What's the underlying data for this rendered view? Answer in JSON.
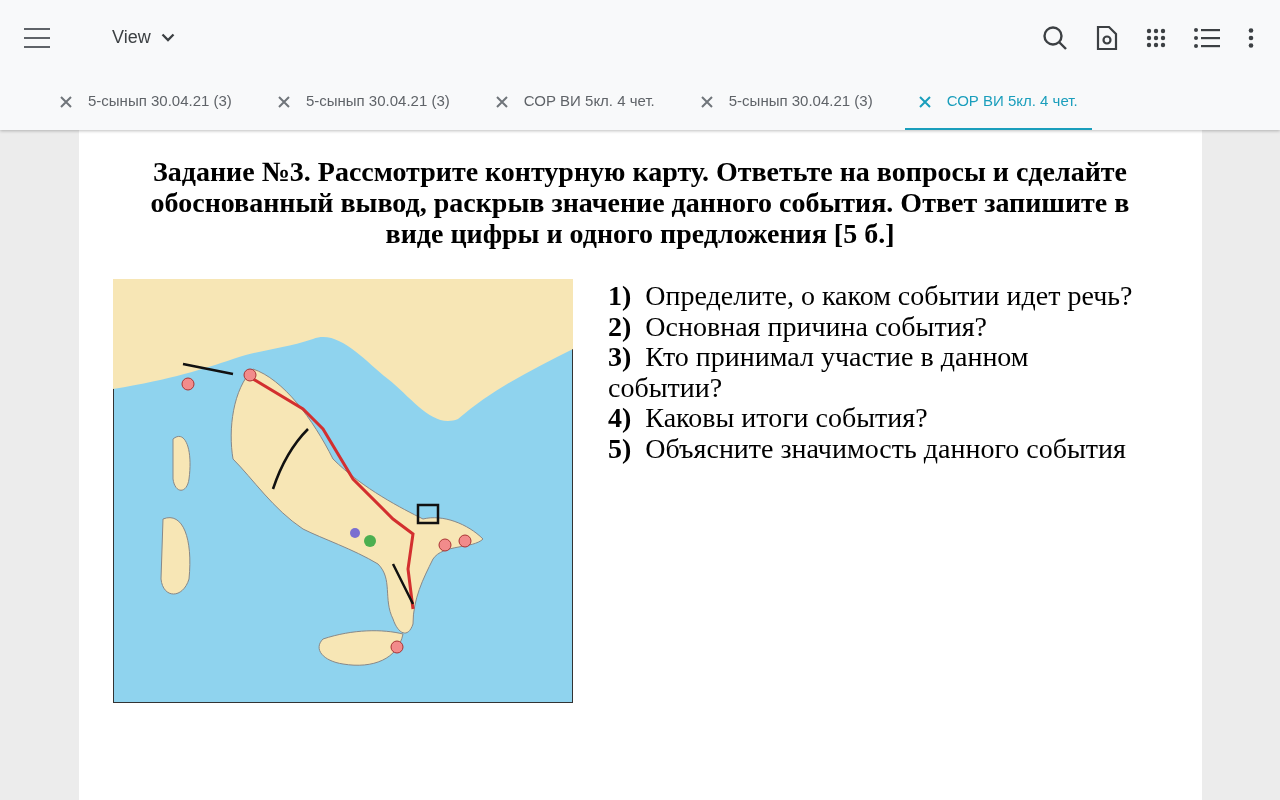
{
  "toolbar": {
    "view_label": "View"
  },
  "tabs": [
    {
      "label": "5-сынып 30.04.21 (3)",
      "selected": false
    },
    {
      "label": "5-сынып 30.04.21 (3)",
      "selected": false
    },
    {
      "label": "СОР ВИ 5кл. 4 чет.",
      "selected": false
    },
    {
      "label": "5-сынып 30.04.21 (3)",
      "selected": false
    },
    {
      "label": "СОР ВИ 5кл. 4 чет.",
      "selected": true
    }
  ],
  "document": {
    "heading": "Задание №3. Рассмотрите контурную карту. Ответьте на вопросы и сделайте обоснованный вывод, раскрыв значение данного события. Ответ запишите в виде цифры и одного предложения [5 б.]",
    "questions": [
      "**1)**  Определите, о каком событии идет речь?",
      "**2)**  Основная причина события?",
      "**3)**  Кто принимал участие в данном событии?",
      "**4)**  Каковы итоги события?",
      "**5)**  Объясните значимость данного события"
    ]
  }
}
